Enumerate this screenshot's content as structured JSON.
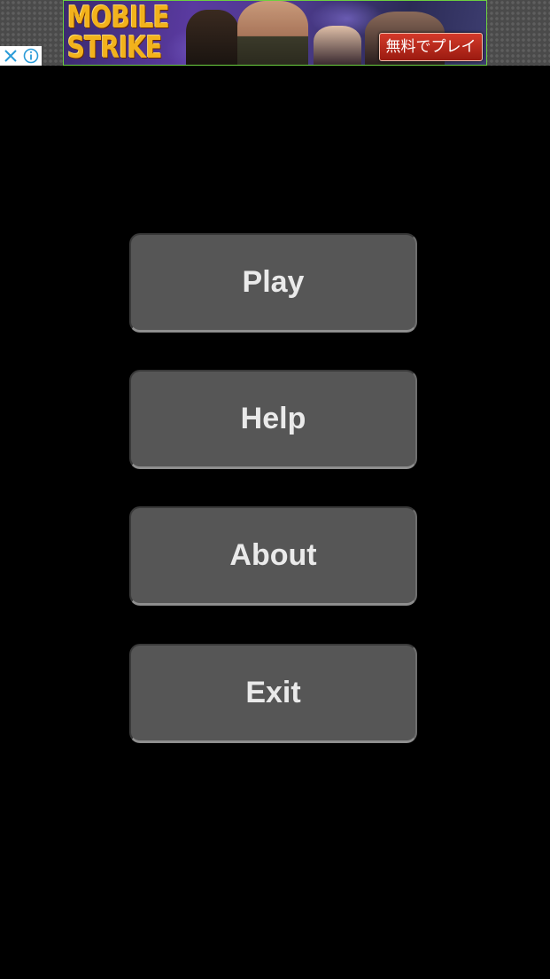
{
  "ad": {
    "title": "MOBILE\nSTRIKE",
    "cta_label": "無料でプレイ",
    "close_icon": "close-icon",
    "info_icon": "info-icon",
    "border_color": "#6ccf3f",
    "accent_color": "#f2b21c"
  },
  "menu": {
    "buttons": [
      {
        "label": "Play"
      },
      {
        "label": "Help"
      },
      {
        "label": "About"
      },
      {
        "label": "Exit"
      }
    ],
    "button_color": "#565656",
    "text_color": "#eaeaea",
    "background_color": "#000000"
  }
}
